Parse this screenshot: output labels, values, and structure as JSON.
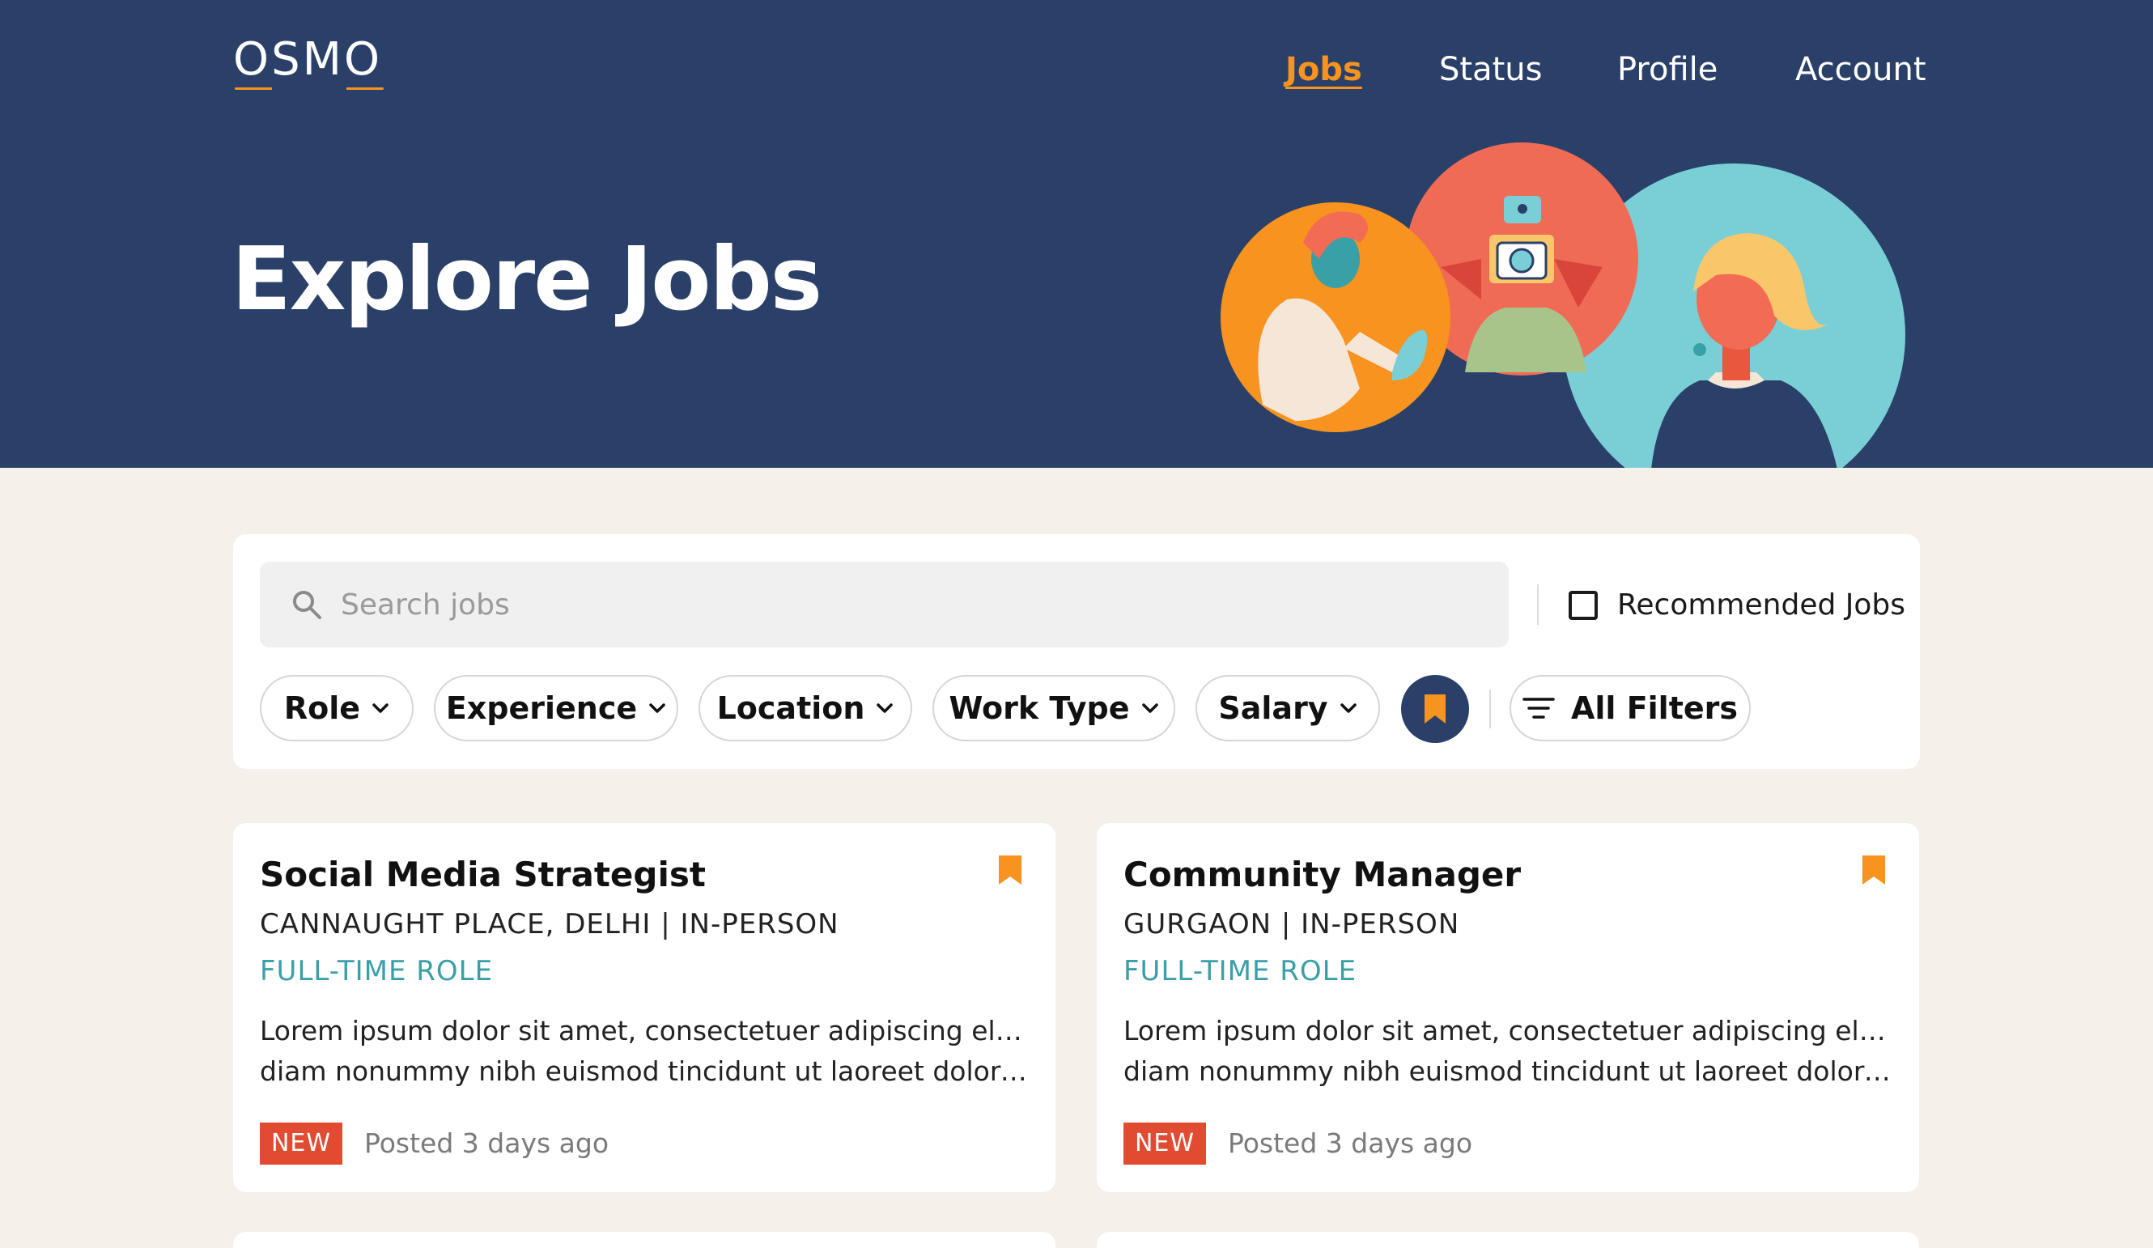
{
  "brand": {
    "logo_text": "OSMO",
    "accent": "#f7931e",
    "header_bg": "#2b4069",
    "page_bg": "#f5f0ea"
  },
  "nav": {
    "items": [
      {
        "label": "Jobs",
        "active": true
      },
      {
        "label": "Status",
        "active": false
      },
      {
        "label": "Profile",
        "active": false
      },
      {
        "label": "Account",
        "active": false
      }
    ]
  },
  "hero": {
    "title": "Explore Jobs",
    "illustration": "three-people-circles-illustration"
  },
  "search": {
    "placeholder": "Search jobs",
    "value": "",
    "icon": "search-icon"
  },
  "recommended": {
    "label": "Recommended Jobs",
    "checked": false
  },
  "filters": {
    "chips": [
      "Role",
      "Experience",
      "Location",
      "Work Type",
      "Salary"
    ],
    "saved_icon": "bookmark-icon",
    "all_filters_label": "All Filters",
    "all_filters_icon": "filter-lines-icon"
  },
  "jobs": [
    {
      "title": "Social Media Strategist",
      "location": "CANNAUGHT PLACE, DELHI | IN-PERSON",
      "type": "FULL-TIME ROLE",
      "desc_line1": "Lorem ipsum dolor sit amet, consectetuer adipiscing elit, sed",
      "desc_line2": "diam nonummy nibh euismod tincidunt ut laoreet dolore mag...",
      "badge": "NEW",
      "posted": "Posted 3 days ago",
      "bookmarked": true
    },
    {
      "title": "Community Manager",
      "location": "GURGAON | IN-PERSON",
      "type": "FULL-TIME ROLE",
      "desc_line1": "Lorem ipsum dolor sit amet, consectetuer adipiscing elit, sed",
      "desc_line2": "diam nonummy nibh euismod tincidunt ut laoreet dolore mag...",
      "badge": "NEW",
      "posted": "Posted 3 days ago",
      "bookmarked": true
    }
  ]
}
